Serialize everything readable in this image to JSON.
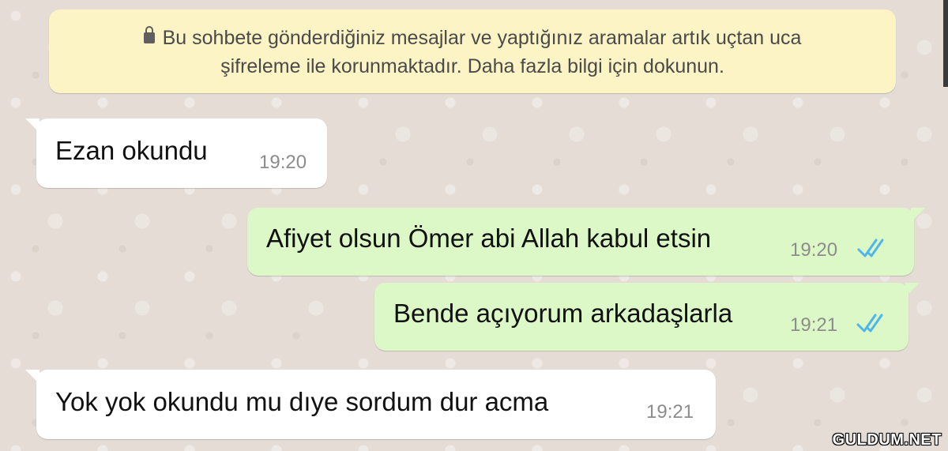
{
  "notice": {
    "icon": "lock-icon",
    "line1": "Bu sohbete gönderdiğiniz mesajlar ve yaptığınız aramalar artık uçtan uca",
    "line2": "şifreleme ile korunmaktadır. Daha fazla bilgi için dokunun."
  },
  "messages": [
    {
      "direction": "incoming",
      "text": "Ezan okundu",
      "time": "19:20"
    },
    {
      "direction": "outgoing",
      "text": "Afiyet olsun Ömer abi Allah kabul etsin",
      "time": "19:20",
      "status": "read"
    },
    {
      "direction": "outgoing",
      "text": "Bende açıyorum arkadaşlarla",
      "time": "19:21",
      "status": "read"
    },
    {
      "direction": "incoming",
      "text": "Yok yok okundu mu dıye sordum dur acma",
      "time": "19:21"
    }
  ],
  "colors": {
    "wallpaper": "#e5ddd5",
    "notice_bg": "#fcf4c4",
    "incoming_bg": "#ffffff",
    "outgoing_bg": "#dcf8c6",
    "read_ticks": "#4fb6ec"
  },
  "watermark": "GULDUM.NET"
}
